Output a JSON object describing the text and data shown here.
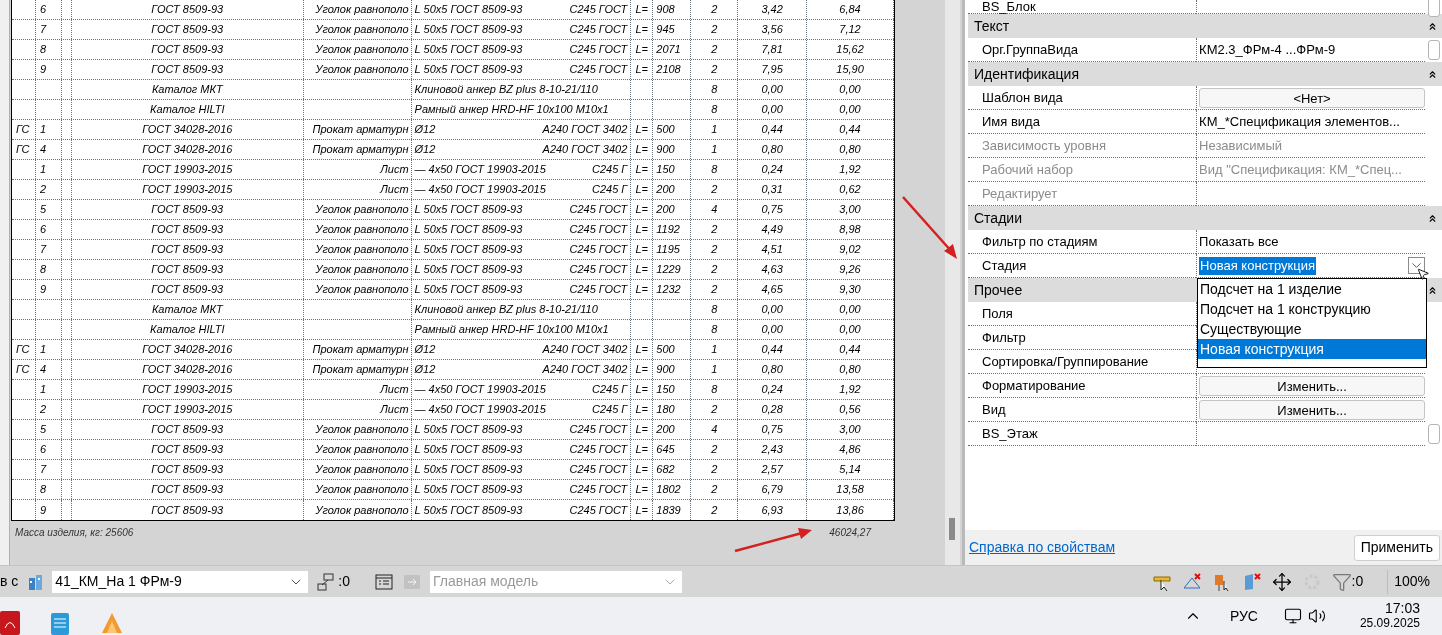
{
  "schedule": {
    "rows": [
      {
        "column_2": "6",
        "column_4": "ГОСТ 8509-93",
        "column_5": "Уголок равнополо",
        "column_6": "L 50x5 ГОСТ 8509-93",
        "column_7": "С245 ГОСТ",
        "column_8": "L=",
        "column_9": "908",
        "column_10": "2",
        "column_11": "3,42",
        "column_12": "6,84"
      },
      {
        "column_2": "7",
        "column_4": "ГОСТ 8509-93",
        "column_5": "Уголок равнополо",
        "column_6": "L 50x5 ГОСТ 8509-93",
        "column_7": "С245 ГОСТ",
        "column_8": "L=",
        "column_9": "945",
        "column_10": "2",
        "column_11": "3,56",
        "column_12": "7,12"
      },
      {
        "column_2": "8",
        "column_4": "ГОСТ 8509-93",
        "column_5": "Уголок равнополо",
        "column_6": "L 50x5 ГОСТ 8509-93",
        "column_7": "С245 ГОСТ",
        "column_8": "L=",
        "column_9": "2071",
        "column_10": "2",
        "column_11": "7,81",
        "column_12": "15,62"
      },
      {
        "column_2": "9",
        "column_4": "ГОСТ 8509-93",
        "column_5": "Уголок равнополо",
        "column_6": "L 50x5 ГОСТ 8509-93",
        "column_7": "С245 ГОСТ",
        "column_8": "L=",
        "column_9": "2108",
        "column_10": "2",
        "column_11": "7,95",
        "column_12": "15,90"
      },
      {
        "column_4": "Каталог МКТ",
        "column_6": "Клиновой анкер BZ plus 8-10-21/110",
        "column_10": "8",
        "column_11": "0,00",
        "column_12": "0,00"
      },
      {
        "column_4": "Каталог HILTI",
        "column_6": "Рамный анкер HRD-HF 10x100 M10x1",
        "column_10": "8",
        "column_11": "0,00",
        "column_12": "0,00"
      },
      {
        "column_1": "ГС",
        "column_2": "1",
        "column_4": "ГОСТ 34028-2016",
        "column_5": "Прокат арматурн",
        "column_6": "Ø12",
        "column_7": "А240 ГОСТ 3402",
        "column_8": "L=",
        "column_9": "500",
        "column_10": "1",
        "column_11": "0,44",
        "column_12": "0,44"
      },
      {
        "column_1": "ГС",
        "column_2": "4",
        "column_4": "ГОСТ 34028-2016",
        "column_5": "Прокат арматурн",
        "column_6": "Ø12",
        "column_7": "А240 ГОСТ 3402",
        "column_8": "L=",
        "column_9": "900",
        "column_10": "1",
        "column_11": "0,80",
        "column_12": "0,80"
      },
      {
        "column_2": "1",
        "column_4": "ГОСТ 19903-2015",
        "column_5": "Лист",
        "column_6": "— 4x50 ГОСТ 19903-2015",
        "column_7": "С245 Г",
        "column_8": "L=",
        "column_9": "150",
        "column_10": "8",
        "column_11": "0,24",
        "column_12": "1,92"
      },
      {
        "column_2": "2",
        "column_4": "ГОСТ 19903-2015",
        "column_5": "Лист",
        "column_6": "— 4x50 ГОСТ 19903-2015",
        "column_7": "С245 Г",
        "column_8": "L=",
        "column_9": "200",
        "column_10": "2",
        "column_11": "0,31",
        "column_12": "0,62"
      },
      {
        "column_2": "5",
        "column_4": "ГОСТ 8509-93",
        "column_5": "Уголок равнополо",
        "column_6": "L 50x5 ГОСТ 8509-93",
        "column_7": "С245 ГОСТ",
        "column_8": "L=",
        "column_9": "200",
        "column_10": "4",
        "column_11": "0,75",
        "column_12": "3,00"
      },
      {
        "column_2": "6",
        "column_4": "ГОСТ 8509-93",
        "column_5": "Уголок равнополо",
        "column_6": "L 50x5 ГОСТ 8509-93",
        "column_7": "С245 ГОСТ",
        "column_8": "L=",
        "column_9": "1192",
        "column_10": "2",
        "column_11": "4,49",
        "column_12": "8,98"
      },
      {
        "column_2": "7",
        "column_4": "ГОСТ 8509-93",
        "column_5": "Уголок равнополо",
        "column_6": "L 50x5 ГОСТ 8509-93",
        "column_7": "С245 ГОСТ",
        "column_8": "L=",
        "column_9": "1195",
        "column_10": "2",
        "column_11": "4,51",
        "column_12": "9,02"
      },
      {
        "column_2": "8",
        "column_4": "ГОСТ 8509-93",
        "column_5": "Уголок равнополо",
        "column_6": "L 50x5 ГОСТ 8509-93",
        "column_7": "С245 ГОСТ",
        "column_8": "L=",
        "column_9": "1229",
        "column_10": "2",
        "column_11": "4,63",
        "column_12": "9,26"
      },
      {
        "column_2": "9",
        "column_4": "ГОСТ 8509-93",
        "column_5": "Уголок равнополо",
        "column_6": "L 50x5 ГОСТ 8509-93",
        "column_7": "С245 ГОСТ",
        "column_8": "L=",
        "column_9": "1232",
        "column_10": "2",
        "column_11": "4,65",
        "column_12": "9,30"
      },
      {
        "column_4": "Каталог МКТ",
        "column_6": "Клиновой анкер BZ plus 8-10-21/110",
        "column_10": "8",
        "column_11": "0,00",
        "column_12": "0,00"
      },
      {
        "column_4": "Каталог HILTI",
        "column_6": "Рамный анкер HRD-HF 10x100 M10x1",
        "column_10": "8",
        "column_11": "0,00",
        "column_12": "0,00"
      },
      {
        "column_1": "ГС",
        "column_2": "1",
        "column_4": "ГОСТ 34028-2016",
        "column_5": "Прокат арматурн",
        "column_6": "Ø12",
        "column_7": "А240 ГОСТ 3402",
        "column_8": "L=",
        "column_9": "500",
        "column_10": "1",
        "column_11": "0,44",
        "column_12": "0,44"
      },
      {
        "column_1": "ГС",
        "column_2": "4",
        "column_4": "ГОСТ 34028-2016",
        "column_5": "Прокат арматурн",
        "column_6": "Ø12",
        "column_7": "А240 ГОСТ 3402",
        "column_8": "L=",
        "column_9": "900",
        "column_10": "1",
        "column_11": "0,80",
        "column_12": "0,80"
      },
      {
        "column_2": "1",
        "column_4": "ГОСТ 19903-2015",
        "column_5": "Лист",
        "column_6": "— 4x50 ГОСТ 19903-2015",
        "column_7": "С245 Г",
        "column_8": "L=",
        "column_9": "150",
        "column_10": "8",
        "column_11": "0,24",
        "column_12": "1,92"
      },
      {
        "column_2": "2",
        "column_4": "ГОСТ 19903-2015",
        "column_5": "Лист",
        "column_6": "— 4x50 ГОСТ 19903-2015",
        "column_7": "С245 Г",
        "column_8": "L=",
        "column_9": "180",
        "column_10": "2",
        "column_11": "0,28",
        "column_12": "0,56"
      },
      {
        "column_2": "5",
        "column_4": "ГОСТ 8509-93",
        "column_5": "Уголок равнополо",
        "column_6": "L 50x5 ГОСТ 8509-93",
        "column_7": "С245 ГОСТ",
        "column_8": "L=",
        "column_9": "200",
        "column_10": "4",
        "column_11": "0,75",
        "column_12": "3,00"
      },
      {
        "column_2": "6",
        "column_4": "ГОСТ 8509-93",
        "column_5": "Уголок равнополо",
        "column_6": "L 50x5 ГОСТ 8509-93",
        "column_7": "С245 ГОСТ",
        "column_8": "L=",
        "column_9": "645",
        "column_10": "2",
        "column_11": "2,43",
        "column_12": "4,86"
      },
      {
        "column_2": "7",
        "column_4": "ГОСТ 8509-93",
        "column_5": "Уголок равнополо",
        "column_6": "L 50x5 ГОСТ 8509-93",
        "column_7": "С245 ГОСТ",
        "column_8": "L=",
        "column_9": "682",
        "column_10": "2",
        "column_11": "2,57",
        "column_12": "5,14"
      },
      {
        "column_2": "8",
        "column_4": "ГОСТ 8509-93",
        "column_5": "Уголок равнополо",
        "column_6": "L 50x5 ГОСТ 8509-93",
        "column_7": "С245 ГОСТ",
        "column_8": "L=",
        "column_9": "1802",
        "column_10": "2",
        "column_11": "6,79",
        "column_12": "13,58"
      },
      {
        "column_2": "9",
        "column_4": "ГОСТ 8509-93",
        "column_5": "Уголок равнополо",
        "column_6": "L 50x5 ГОСТ 8509-93",
        "column_7": "С245 ГОСТ",
        "column_8": "L=",
        "column_9": "1839",
        "column_10": "2",
        "column_11": "6,93",
        "column_12": "13,86"
      }
    ],
    "footer_label": "Масса изделия, кг: 25606",
    "footer_total": "46024,27"
  },
  "properties": {
    "rows": [
      {
        "kind": "text",
        "label": "BS_Блок",
        "disabled": false,
        "side_button": true
      },
      {
        "kind": "group",
        "label": "Текст",
        "expanded": true
      },
      {
        "kind": "text",
        "label": "Орг.ГруппаВида",
        "value": "КМ2.3_ФРм-4 ...ФРм-9",
        "disabled": false,
        "side_button": true
      },
      {
        "kind": "group",
        "label": "Идентификация",
        "expanded": true
      },
      {
        "kind": "button",
        "label": "Шаблон вида",
        "value": "<Нет>",
        "disabled": false,
        "side_button": false
      },
      {
        "kind": "text",
        "label": "Имя вида",
        "value": "КМ_*Спецификация элементов...",
        "disabled": false,
        "side_button": false
      },
      {
        "kind": "text",
        "label": "Зависимость уровня",
        "value": "Независимый",
        "disabled": true,
        "side_button": false
      },
      {
        "kind": "text",
        "label": "Рабочий набор",
        "value": "Вид \"Спецификация: КМ_*Спец...",
        "disabled": true,
        "side_button": false
      },
      {
        "kind": "text",
        "label": "Редактирует",
        "disabled": true,
        "side_button": false
      },
      {
        "kind": "group",
        "label": "Стадии",
        "expanded": true
      },
      {
        "kind": "text",
        "label": "Фильтр по стадиям",
        "value": "Показать все",
        "disabled": false,
        "side_button": false
      },
      {
        "kind": "dropdown",
        "label": "Стадия",
        "value": "Новая конструкция",
        "disabled": false,
        "side_button": false,
        "open": true,
        "options": [
          {
            "label": "Подсчет на 1 изделие",
            "selected": false
          },
          {
            "label": "Подсчет на 1 конструкцию",
            "selected": false
          },
          {
            "label": "Существующие",
            "selected": false
          },
          {
            "label": "Новая конструкция",
            "selected": true
          }
        ]
      },
      {
        "kind": "group",
        "label": "Прочее",
        "expanded": true
      },
      {
        "kind": "text",
        "label": "Поля",
        "disabled": false,
        "side_button": false
      },
      {
        "kind": "text",
        "label": "Фильтр",
        "disabled": false,
        "side_button": false
      },
      {
        "kind": "text",
        "label": "Сортировка/Группирование",
        "disabled": false,
        "side_button": false
      },
      {
        "kind": "button",
        "label": "Форматирование",
        "value": "Изменить...",
        "disabled": false,
        "side_button": false
      },
      {
        "kind": "button",
        "label": "Вид",
        "value": "Изменить...",
        "disabled": false,
        "side_button": false
      },
      {
        "kind": "text",
        "label": "BS_Этаж",
        "disabled": false,
        "side_button": true
      }
    ],
    "help_link": "Справка по свойствам",
    "apply_button": "Применить"
  },
  "status_bar": {
    "cut_text": "в с",
    "view_combo": "41_КМ_На 1 ФРм-9",
    "worksets_count": ":0",
    "model_combo": "Главная модель",
    "filter_count": ":0",
    "zoom": "100%"
  },
  "taskbar": {
    "language": "РУС",
    "time": "17:03",
    "date": "25.09.2025"
  }
}
